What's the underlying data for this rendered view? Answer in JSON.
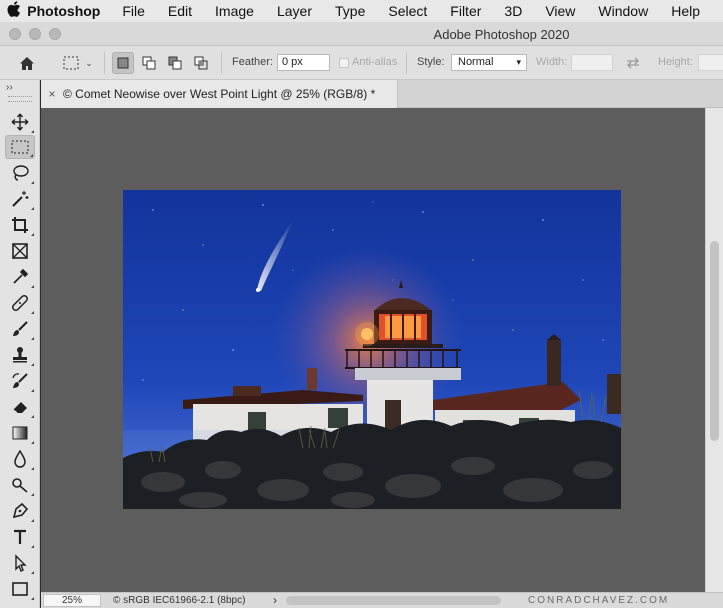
{
  "menubar": {
    "apple_icon": "apple-logo",
    "items": [
      "Photoshop",
      "File",
      "Edit",
      "Image",
      "Layer",
      "Type",
      "Select",
      "Filter",
      "3D",
      "View",
      "Window",
      "Help"
    ]
  },
  "window": {
    "title": "Adobe Photoshop 2020"
  },
  "options": {
    "feather_label": "Feather:",
    "feather_value": "0 px",
    "antialias_label": "Anti-alias",
    "style_label": "Style:",
    "style_value": "Normal",
    "width_label": "Width:",
    "height_label": "Height:"
  },
  "toolbar": {
    "collapse": "››",
    "tools": [
      {
        "name": "move-tool",
        "icon": "move-icon"
      },
      {
        "name": "rectangular-marquee-tool",
        "icon": "marquee-icon",
        "selected": true
      },
      {
        "name": "lasso-tool",
        "icon": "lasso-icon"
      },
      {
        "name": "magic-wand-tool",
        "icon": "magic-wand-icon"
      },
      {
        "name": "crop-tool",
        "icon": "crop-icon"
      },
      {
        "name": "frame-tool",
        "icon": "frame-icon"
      },
      {
        "name": "eyedropper-tool",
        "icon": "eyedropper-icon"
      },
      {
        "name": "healing-brush-tool",
        "icon": "bandage-icon"
      },
      {
        "name": "brush-tool",
        "icon": "brush-icon"
      },
      {
        "name": "clone-stamp-tool",
        "icon": "stamp-icon"
      },
      {
        "name": "history-brush-tool",
        "icon": "history-brush-icon"
      },
      {
        "name": "eraser-tool",
        "icon": "eraser-icon"
      },
      {
        "name": "gradient-tool",
        "icon": "gradient-icon"
      },
      {
        "name": "blur-tool",
        "icon": "blur-icon"
      },
      {
        "name": "dodge-tool",
        "icon": "dodge-icon"
      },
      {
        "name": "pen-tool",
        "icon": "pen-icon"
      },
      {
        "name": "type-tool",
        "icon": "type-icon"
      },
      {
        "name": "path-selection-tool",
        "icon": "arrow-icon"
      },
      {
        "name": "rectangle-tool",
        "icon": "rectangle-icon"
      }
    ]
  },
  "document": {
    "close": "×",
    "tab_title": "© Comet Neowise over West Point Light @ 25% (RGB/8) *"
  },
  "status": {
    "zoom": "25%",
    "profile": "© sRGB IEC61966-2.1 (8bpc)",
    "arrow": "›",
    "watermark": "CONRADCHAVEZ.COM"
  },
  "colors": {
    "sky_top": "#16389e",
    "sky_bottom": "#3a5fd0",
    "glow": "#c8705a",
    "lantern": "#ff7a2a",
    "building": "#e9e7e2",
    "roof": "#5a2b22"
  }
}
